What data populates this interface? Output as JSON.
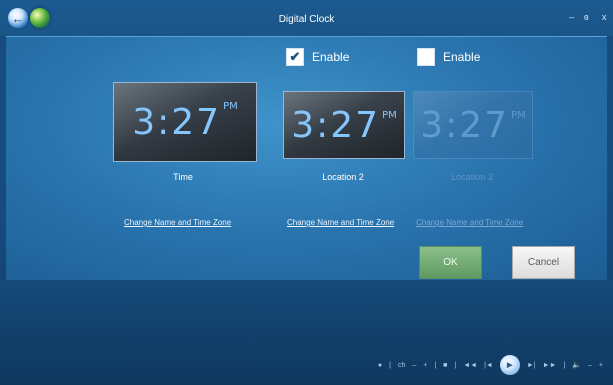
{
  "window": {
    "title": "Digital Clock",
    "controls": {
      "minimize": "–",
      "restore": "ɞ",
      "close": "x"
    }
  },
  "enable_checkboxes": [
    {
      "label": "Enable",
      "checked": true
    },
    {
      "label": "Enable",
      "checked": false
    }
  ],
  "clocks": [
    {
      "time": "3:27",
      "ampm": "PM",
      "label": "Time",
      "link": "Change Name and Time Zone",
      "enabled": true
    },
    {
      "time": "3:27",
      "ampm": "PM",
      "label": "Location 2",
      "link": "Change Name and Time Zone",
      "enabled": true
    },
    {
      "time": "3:27",
      "ampm": "PM",
      "label": "Location 3",
      "link": "Change Name and Time Zone",
      "enabled": false
    }
  ],
  "buttons": {
    "ok": "OK",
    "cancel": "Cancel"
  },
  "transport": {
    "items": [
      "●",
      "|",
      "ch",
      "–",
      "+",
      "|",
      "■",
      "|",
      "◄◄",
      "|◄",
      "►",
      "►|",
      "►►",
      "|",
      "🔈",
      "–",
      "+"
    ]
  },
  "colors": {
    "accent": "#2f7fb8",
    "clock_digits": "#86c6ff",
    "ok_green": "#6faa70"
  }
}
